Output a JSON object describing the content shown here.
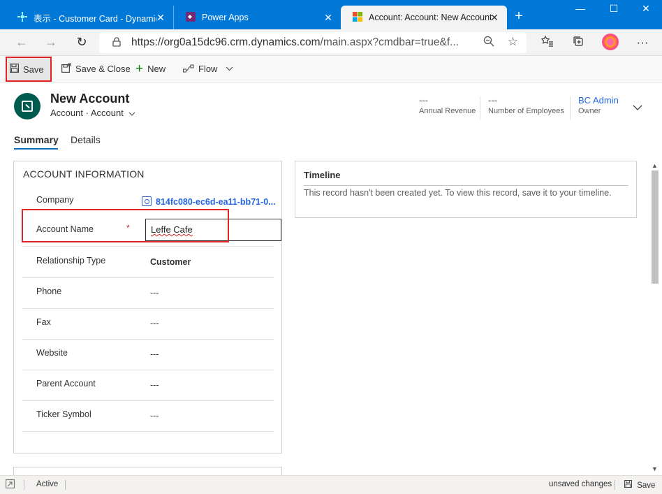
{
  "browser": {
    "tabs": [
      {
        "title": "表示 - Customer Card - Dynamic",
        "icon": "dynamics-icon"
      },
      {
        "title": "Power Apps",
        "icon": "power-apps-icon"
      },
      {
        "title": "Account: Account: New Account",
        "icon": "microsoft-icon"
      }
    ],
    "url_main": "https://org0a15dc96.crm.dynamics.com",
    "url_rest": "/main.aspx?cmdbar=true&f..."
  },
  "toolbar": {
    "save_label": "Save",
    "save_close_label": "Save & Close",
    "new_label": "New",
    "flow_label": "Flow"
  },
  "header": {
    "title": "New Account",
    "entity": "Account",
    "form": "Account",
    "annual_revenue_value": "---",
    "annual_revenue_label": "Annual Revenue",
    "employees_value": "---",
    "employees_label": "Number of Employees",
    "owner_value": "BC Admin",
    "owner_label": "Owner"
  },
  "form_tabs": {
    "summary": "Summary",
    "details": "Details"
  },
  "account_info": {
    "title": "ACCOUNT INFORMATION",
    "company_label": "Company",
    "company_value": "814fc080-ec6d-ea11-bb71-0...",
    "account_name_label": "Account Name",
    "required_marker": "*",
    "account_name_value": "Leffe Cafe",
    "relationship_label": "Relationship Type",
    "relationship_value": "Customer",
    "phone_label": "Phone",
    "phone_value": "---",
    "fax_label": "Fax",
    "fax_value": "---",
    "website_label": "Website",
    "website_value": "---",
    "parent_label": "Parent Account",
    "parent_value": "---",
    "ticker_label": "Ticker Symbol",
    "ticker_value": "---"
  },
  "timeline": {
    "title": "Timeline",
    "message": "This record hasn't been created yet.  To view this record, save it to your timeline."
  },
  "status": {
    "state": "Active",
    "changes": "unsaved changes",
    "save_label": "Save"
  },
  "colors": {
    "brand_blue": "#0078d7",
    "link_blue": "#2266e3",
    "avatar_green": "#005b4f",
    "highlight_red": "#e02424"
  }
}
